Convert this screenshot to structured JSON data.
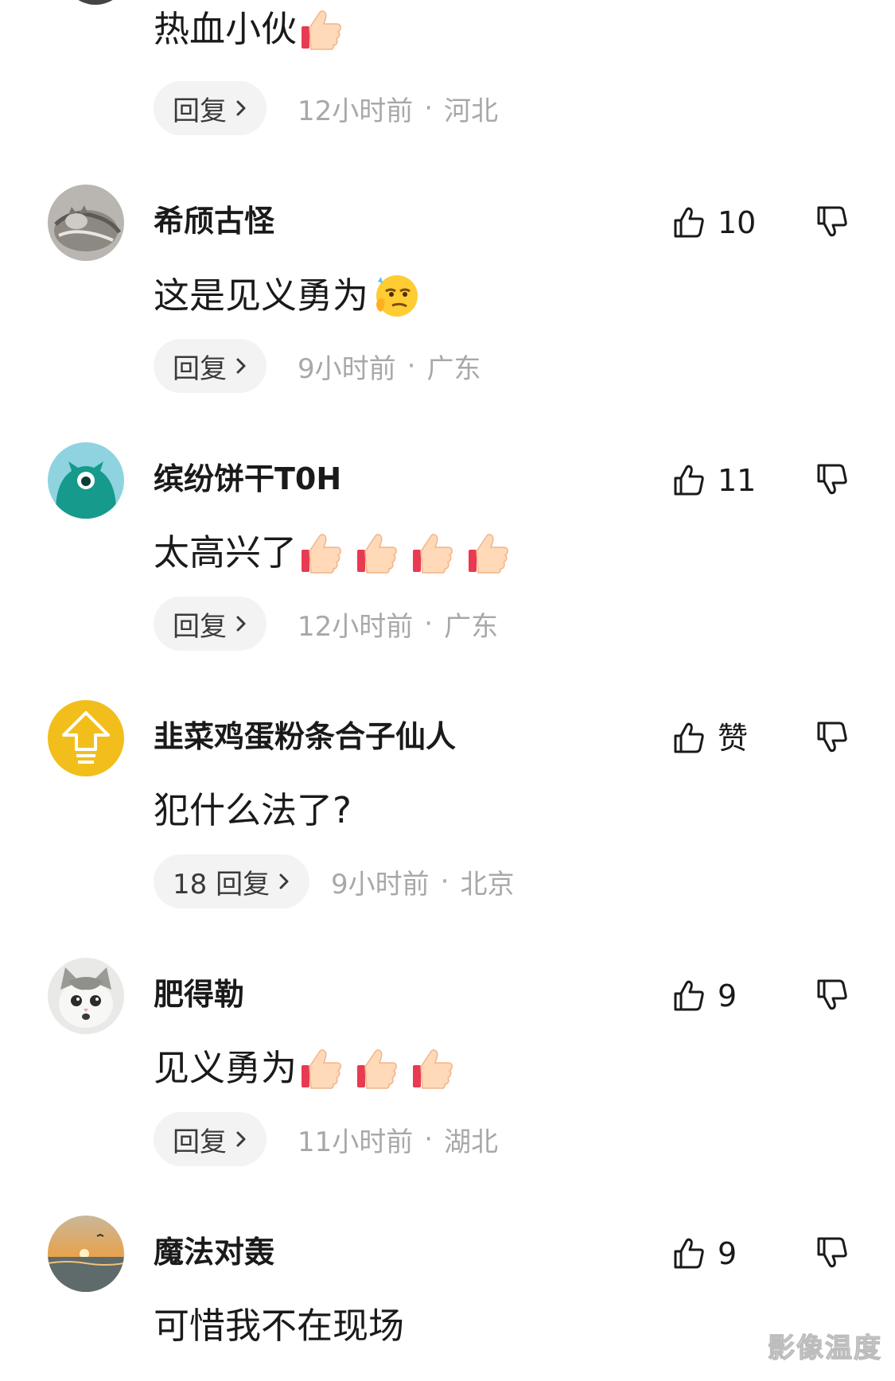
{
  "first_comment": {
    "text": "热血小伙",
    "emojis": [
      "thumbs-up-emoji"
    ],
    "reply_label": "回复",
    "time": "12小时前",
    "location": "河北"
  },
  "comments": [
    {
      "username": "希颀古怪",
      "likes": "10",
      "text": "这是见义勇为",
      "emojis": [
        "thinking-smirk-emoji"
      ],
      "reply_label": "回复",
      "time": "9小时前",
      "location": "广东",
      "avatar": "cat-photo-avatar"
    },
    {
      "username": "缤纷饼干T0H",
      "likes": "11",
      "text": "太高兴了",
      "emojis": [
        "thumbs-up-emoji",
        "thumbs-up-emoji",
        "thumbs-up-emoji",
        "thumbs-up-emoji"
      ],
      "reply_label": "回复",
      "time": "12小时前",
      "location": "广东",
      "avatar": "teal-monster-avatar"
    },
    {
      "username": "韭菜鸡蛋粉条合子仙人",
      "likes": "赞",
      "text": "犯什么法了?",
      "emojis": [],
      "reply_label": "18 回复",
      "time": "9小时前",
      "location": "北京",
      "avatar": "yellow-arrow-avatar"
    },
    {
      "username": "肥得勒",
      "likes": "9",
      "text": "见义勇为",
      "emojis": [
        "thumbs-up-emoji",
        "thumbs-up-emoji",
        "thumbs-up-emoji"
      ],
      "reply_label": "回复",
      "time": "11小时前",
      "location": "湖北",
      "avatar": "white-cat-avatar"
    },
    {
      "username": "魔法对轰",
      "likes": "9",
      "text": "可惜我不在现场",
      "emojis": [],
      "avatar": "sunset-sea-avatar"
    }
  ],
  "meta_separator": "·",
  "watermark": "影像温度",
  "colors": {
    "meta_gray": "#a8a8a8",
    "reply_bg": "#f3f3f3",
    "text": "#1a1a1a"
  }
}
